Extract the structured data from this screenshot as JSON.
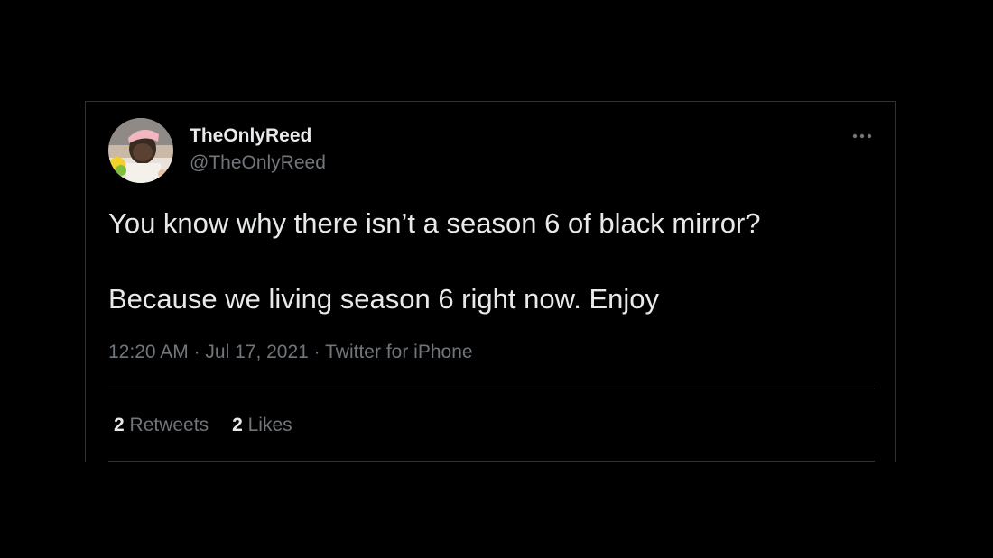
{
  "tweet": {
    "display_name": "TheOnlyReed",
    "handle": "@TheOnlyReed",
    "text_lines": [
      "You know why there isn’t a season 6 of black mirror?",
      "Because we living season 6 right now. Enjoy"
    ],
    "time": "12:20 AM",
    "date": "Jul 17, 2021",
    "source": "Twitter for iPhone",
    "separator": " · ",
    "retweets": {
      "count": "2",
      "label": "Retweets"
    },
    "likes": {
      "count": "2",
      "label": "Likes"
    },
    "more_icon": "more-horizontal-icon",
    "avatar_icon": "avatar-photo"
  },
  "colors": {
    "background": "#000000",
    "primary_text": "#e7e9ea",
    "secondary_text": "#71767b",
    "border": "#2f3336"
  }
}
